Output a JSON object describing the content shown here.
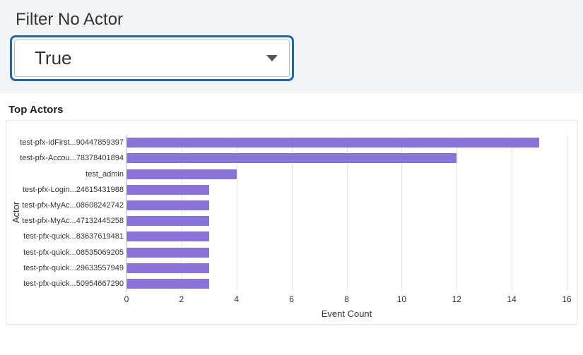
{
  "filter": {
    "label": "Filter No Actor",
    "selected": "True"
  },
  "chart_title": "Top Actors",
  "chart_data": {
    "type": "bar",
    "orientation": "horizontal",
    "title": "Top Actors",
    "xlabel": "Event Count",
    "ylabel": "Actor",
    "xlim": [
      0,
      16
    ],
    "xticks": [
      0,
      2,
      4,
      6,
      8,
      10,
      12,
      14,
      16
    ],
    "categories": [
      "test-pfx-IdFirst...90447859397",
      "test-pfx-Accou...78378401894",
      "test_admin",
      "test-pfx-Login...24615431988",
      "test-pfx-MyAc...08608242742",
      "test-pfx-MyAc...47132445258",
      "test-pfx-quick...83637619481",
      "test-pfx-quick...08535069205",
      "test-pfx-quick...29633557949",
      "test-pfx-quick...50954667290"
    ],
    "values": [
      15,
      12,
      4,
      3,
      3,
      3,
      3,
      3,
      3,
      3
    ],
    "bar_color": "#8a73d9"
  }
}
